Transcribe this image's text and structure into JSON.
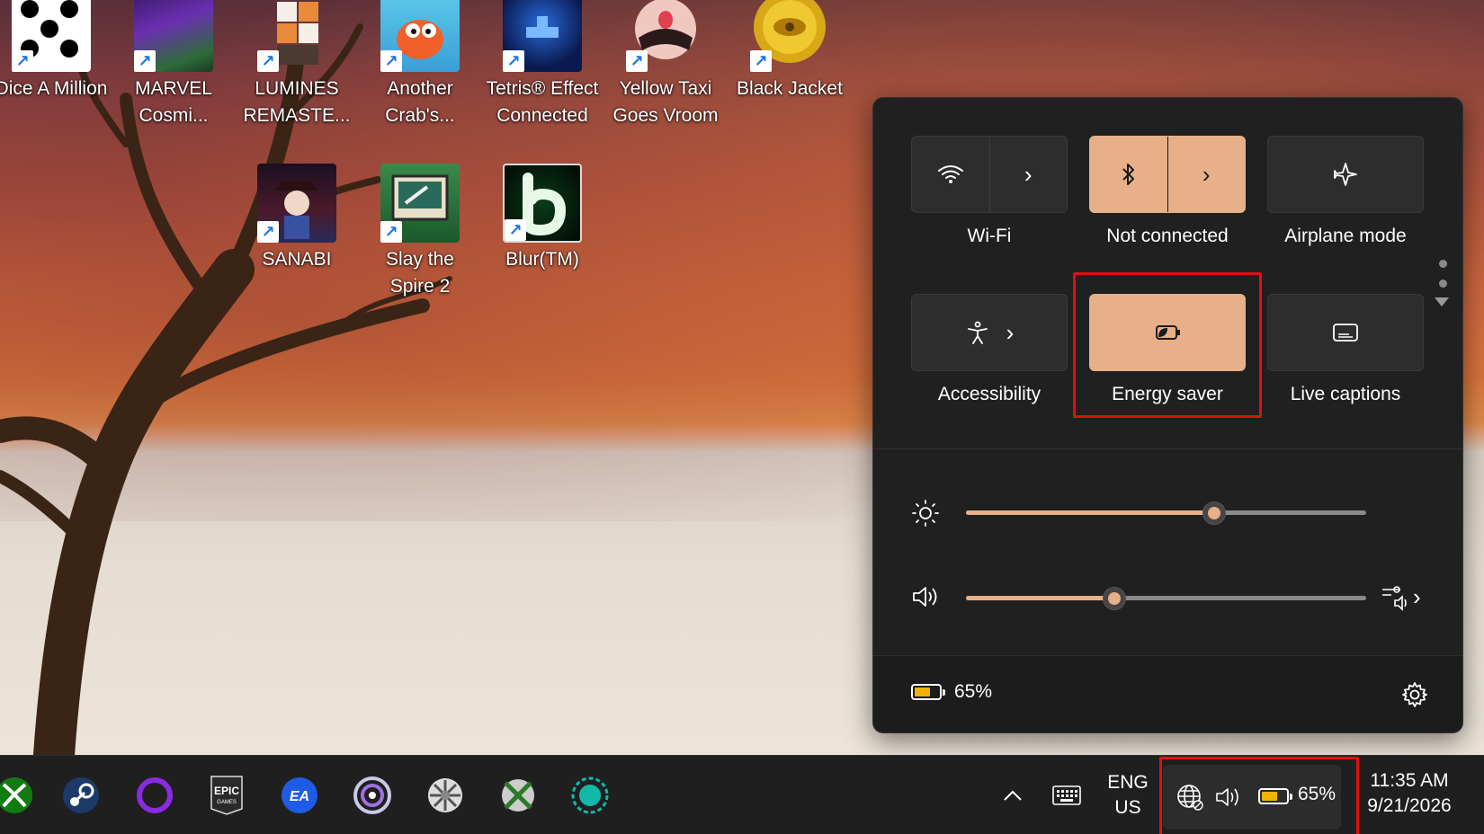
{
  "desktop": {
    "icons": [
      {
        "label": "Dice A Million",
        "icon": "dice-icon"
      },
      {
        "label": "MARVEL Cosmi...",
        "icon": "marvel-game-icon"
      },
      {
        "label": "LUMINES REMASTE...",
        "icon": "lumines-icon"
      },
      {
        "label": "Another Crab's...",
        "icon": "crab-game-icon"
      },
      {
        "label": "Tetris® Effect Connected",
        "icon": "tetris-icon"
      },
      {
        "label": "Yellow Taxi Goes Vroom",
        "icon": "taxi-game-icon"
      },
      {
        "label": "Black Jacket",
        "icon": "black-jacket-icon"
      },
      {
        "label": "SANABI",
        "icon": "sanabi-icon"
      },
      {
        "label": "Slay the Spire 2",
        "icon": "slay-spire-icon"
      },
      {
        "label": "Blur(TM)",
        "icon": "blur-icon"
      }
    ]
  },
  "quick_settings": {
    "tiles": [
      {
        "label": "Wi-Fi",
        "icon": "wifi-icon",
        "active": false,
        "has_arrow": true
      },
      {
        "label": "Not connected",
        "icon": "bluetooth-icon",
        "active": true,
        "has_arrow": true
      },
      {
        "label": "Airplane mode",
        "icon": "airplane-icon",
        "active": false,
        "has_arrow": false
      },
      {
        "label": "Accessibility",
        "icon": "accessibility-icon",
        "active": false,
        "has_arrow": true
      },
      {
        "label": "Energy saver",
        "icon": "energy-saver-icon",
        "active": true,
        "has_arrow": false
      },
      {
        "label": "Live captions",
        "icon": "captions-icon",
        "active": false,
        "has_arrow": false
      }
    ],
    "brightness_level": 0.62,
    "volume_level": 0.37,
    "battery_text": "65%",
    "battery_level": 0.65,
    "accent_color": "#e8b089"
  },
  "taskbar": {
    "apps": [
      "xbox-icon",
      "steam-icon",
      "purple-ring-app-icon",
      "epic-games-icon",
      "ea-icon",
      "ubisoft-icon",
      "wheel-app-icon",
      "xbox-game-bar-icon",
      "teal-ring-app-icon"
    ],
    "language_line1": "ENG",
    "language_line2": "US",
    "battery_text": "65%",
    "time": "11:35 AM",
    "date": "9/21/2026"
  }
}
